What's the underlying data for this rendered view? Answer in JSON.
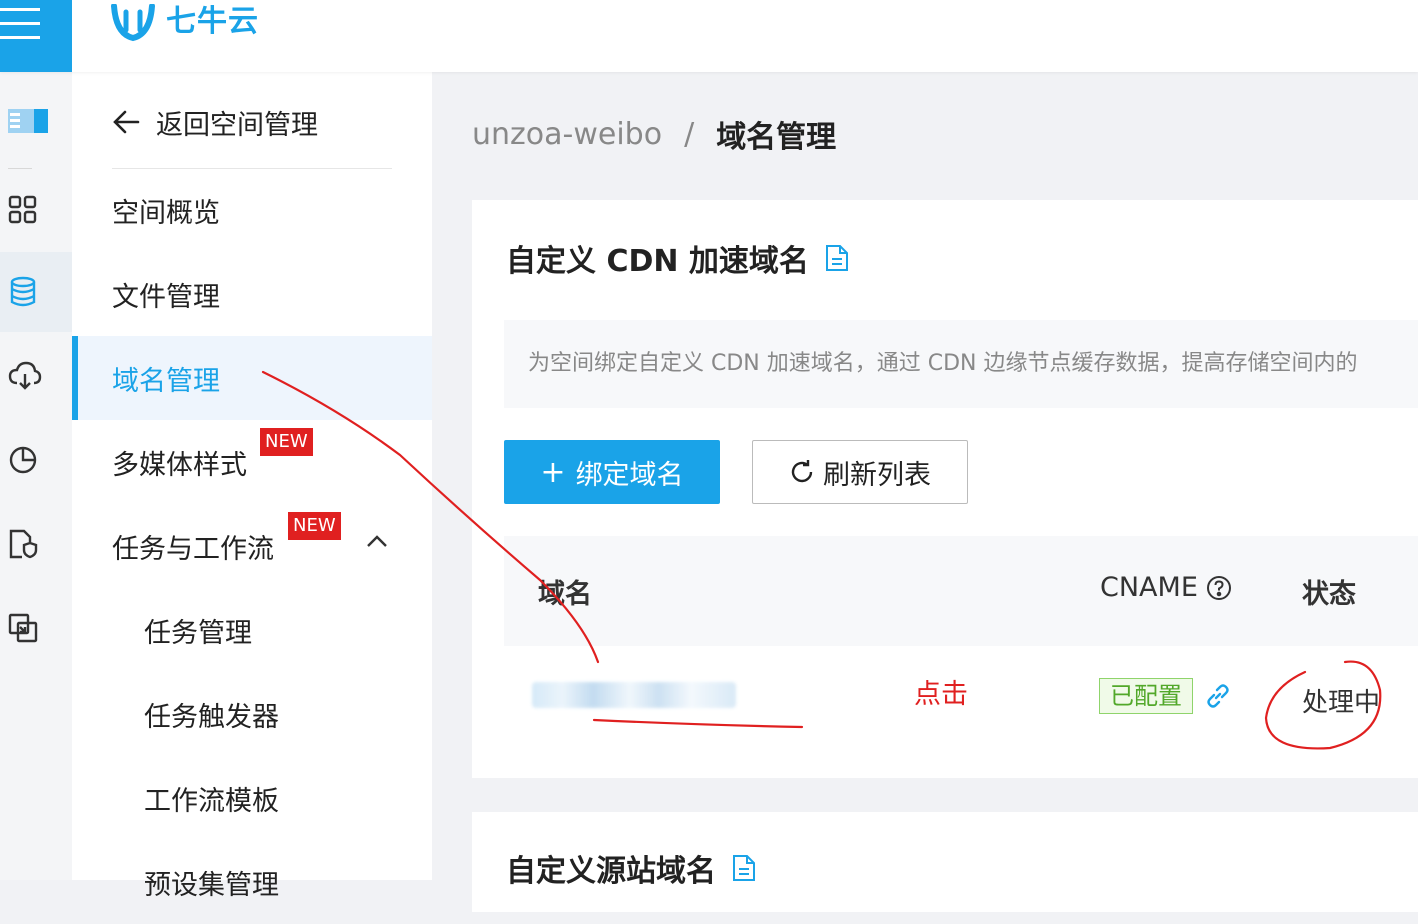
{
  "header": {
    "brand": "七牛云"
  },
  "rail": {
    "icons": [
      "storage-icon",
      "apps-grid-icon",
      "database-icon",
      "cloud-icon",
      "pie-chart-icon",
      "file-shield-icon",
      "transfer-icon"
    ]
  },
  "subnav": {
    "back_label": "返回空间管理",
    "items": [
      {
        "label": "空间概览"
      },
      {
        "label": "文件管理"
      },
      {
        "label": "域名管理"
      },
      {
        "label": "多媒体样式",
        "badge": "NEW"
      },
      {
        "label": "任务与工作流",
        "badge": "NEW"
      },
      {
        "label": "任务管理"
      },
      {
        "label": "任务触发器"
      },
      {
        "label": "工作流模板"
      },
      {
        "label": "预设集管理"
      }
    ]
  },
  "breadcrumb": {
    "space": "unzoa-weibo",
    "separator": "/",
    "current": "域名管理"
  },
  "cdn_section": {
    "title": "自定义 CDN 加速域名",
    "info": "为空间绑定自定义 CDN 加速域名，通过 CDN 边缘节点缓存数据，提高存储空间内的",
    "bind_button": "绑定域名",
    "bind_plus": "+",
    "refresh_button": "刷新列表",
    "table": {
      "headers": {
        "domain": "域名",
        "cname": "CNAME",
        "status": "状态"
      },
      "rows": [
        {
          "cname_tag": "已配置",
          "status": "处理中"
        }
      ]
    }
  },
  "origin_section": {
    "title": "自定义源站域名"
  },
  "annotation": {
    "click_label": "点击",
    "color": "#e02020"
  },
  "colors": {
    "accent": "#1aa3e8",
    "success": "#52a82a",
    "new_badge": "#e02020"
  }
}
